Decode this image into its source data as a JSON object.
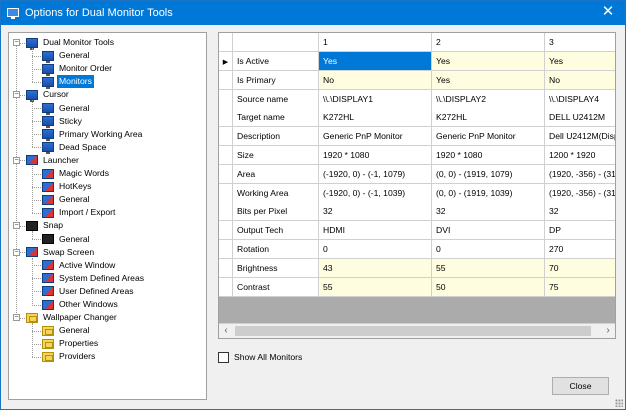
{
  "window": {
    "title": "Options for Dual Monitor Tools",
    "close_glyph": "✕"
  },
  "tree": [
    {
      "label": "Dual Monitor Tools",
      "level": 0,
      "icon": "monitor-icon",
      "expanded": true,
      "selected": false
    },
    {
      "label": "General",
      "level": 1,
      "icon": "monitor-icon",
      "selected": false
    },
    {
      "label": "Monitor Order",
      "level": 1,
      "icon": "monitor-icon",
      "selected": false
    },
    {
      "label": "Monitors",
      "level": 1,
      "icon": "monitor-icon",
      "selected": true
    },
    {
      "label": "Cursor",
      "level": 0,
      "icon": "monitor-icon",
      "expanded": true,
      "selected": false
    },
    {
      "label": "General",
      "level": 1,
      "icon": "monitor-icon",
      "selected": false
    },
    {
      "label": "Sticky",
      "level": 1,
      "icon": "monitor-icon",
      "selected": false
    },
    {
      "label": "Primary Working Area",
      "level": 1,
      "icon": "monitor-icon",
      "selected": false
    },
    {
      "label": "Dead Space",
      "level": 1,
      "icon": "monitor-icon",
      "selected": false
    },
    {
      "label": "Launcher",
      "level": 0,
      "icon": "monitor-red-icon",
      "expanded": true,
      "selected": false
    },
    {
      "label": "Magic Words",
      "level": 1,
      "icon": "monitor-red-icon",
      "selected": false
    },
    {
      "label": "HotKeys",
      "level": 1,
      "icon": "monitor-red-icon",
      "selected": false
    },
    {
      "label": "General",
      "level": 1,
      "icon": "monitor-red-icon",
      "selected": false
    },
    {
      "label": "Import / Export",
      "level": 1,
      "icon": "monitor-red-icon",
      "selected": false
    },
    {
      "label": "Snap",
      "level": 0,
      "icon": "snap-icon",
      "expanded": true,
      "selected": false
    },
    {
      "label": "General",
      "level": 1,
      "icon": "snap-icon",
      "selected": false
    },
    {
      "label": "Swap Screen",
      "level": 0,
      "icon": "monitor-red-icon",
      "expanded": true,
      "selected": false
    },
    {
      "label": "Active Window",
      "level": 1,
      "icon": "monitor-red-icon",
      "selected": false
    },
    {
      "label": "System Defined Areas",
      "level": 1,
      "icon": "monitor-red-icon",
      "selected": false
    },
    {
      "label": "User Defined Areas",
      "level": 1,
      "icon": "monitor-red-icon",
      "selected": false
    },
    {
      "label": "Other Windows",
      "level": 1,
      "icon": "monitor-red-icon",
      "selected": false
    },
    {
      "label": "Wallpaper Changer",
      "level": 0,
      "icon": "wallpaper-icon",
      "expanded": true,
      "selected": false
    },
    {
      "label": "General",
      "level": 1,
      "icon": "wallpaper-icon",
      "selected": false
    },
    {
      "label": "Properties",
      "level": 1,
      "icon": "wallpaper-icon",
      "selected": false
    },
    {
      "label": "Providers",
      "level": 1,
      "icon": "wallpaper-icon",
      "selected": false
    }
  ],
  "grid": {
    "columns": [
      "1",
      "2",
      "3"
    ],
    "rows": [
      {
        "label": "Is Active",
        "values": [
          "Yes",
          "Yes",
          "Yes"
        ],
        "current": true,
        "editable": true
      },
      {
        "label": "Is Primary",
        "values": [
          "No",
          "Yes",
          "No"
        ],
        "editable": true
      },
      {
        "label": "Source name",
        "values": [
          "\\\\.\\DISPLAY1",
          "\\\\.\\DISPLAY2",
          "\\\\.\\DISPLAY4"
        ]
      },
      {
        "label": "Target name",
        "values": [
          "K272HL",
          "K272HL",
          "DELL U2412M"
        ]
      },
      {
        "label": "Description",
        "values": [
          "Generic PnP Monitor",
          "Generic PnP Monitor",
          "Dell U2412M(Disp"
        ]
      },
      {
        "label": "Size",
        "values": [
          "1920 * 1080",
          "1920 * 1080",
          "1200 * 1920"
        ]
      },
      {
        "label": "Area",
        "values": [
          "(-1920, 0) - (-1, 1079)",
          "(0, 0) - (1919, 1079)",
          "(1920, -356) - (31"
        ]
      },
      {
        "label": "Working Area",
        "values": [
          "(-1920, 0) - (-1, 1039)",
          "(0, 0) - (1919, 1039)",
          "(1920, -356) - (31"
        ]
      },
      {
        "label": "Bits per Pixel",
        "values": [
          "32",
          "32",
          "32"
        ]
      },
      {
        "label": "Output Tech",
        "values": [
          "HDMI",
          "DVI",
          "DP"
        ]
      },
      {
        "label": "Rotation",
        "values": [
          "0",
          "0",
          "270"
        ]
      },
      {
        "label": "Brightness",
        "values": [
          "43",
          "55",
          "70"
        ],
        "editable": true
      },
      {
        "label": "Contrast",
        "values": [
          "55",
          "50",
          "75"
        ],
        "editable": true
      }
    ],
    "current_row_glyph": "▶",
    "scroll_left": "‹",
    "scroll_right": "›"
  },
  "show_all_monitors": {
    "label": "Show All Monitors",
    "checked": false
  },
  "close_button": "Close"
}
